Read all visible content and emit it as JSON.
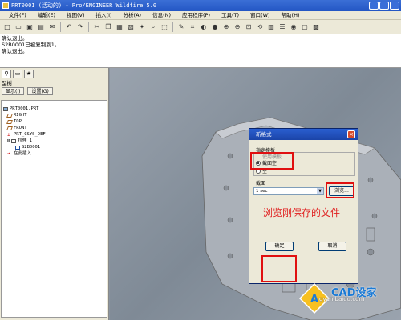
{
  "window": {
    "title": "PRT0001 (活动的) - Pro/ENGINEER Wildfire 5.0"
  },
  "menu": [
    "文件(F)",
    "编辑(E)",
    "视图(V)",
    "插入(I)",
    "分析(A)",
    "信息(N)",
    "应用程序(P)",
    "工具(T)",
    "窗口(W)",
    "帮助(H)"
  ],
  "messages": [
    "确认退出。",
    "S2B0001已被复制到1。",
    "确认退出。"
  ],
  "model_tree": {
    "header": "型树",
    "show_button": "显示(I)",
    "settings_button": "设置(G)",
    "items": [
      "PRT0001.PRT",
      "RIGHT",
      "TOP",
      "FRONT",
      "PRT_CSYS_DEF",
      "拉伸 1",
      "S2B0001",
      "在此插入"
    ]
  },
  "dialog": {
    "title": "新格式",
    "group_template": "指定模板",
    "option_template": "使用模板",
    "option_empty_section": "截面空",
    "option_empty": "空",
    "group_section": "截面",
    "section_value": "1 sec",
    "browse_button": "浏览...",
    "ok_button": "确定",
    "cancel_button": "取消"
  },
  "annotation": "浏览刚保存的文件",
  "watermark": {
    "brand": "CAD设家",
    "url": "gyan.baidu.com"
  },
  "colors": {
    "highlight": "#e01010",
    "titlebar": "#2356c4"
  }
}
